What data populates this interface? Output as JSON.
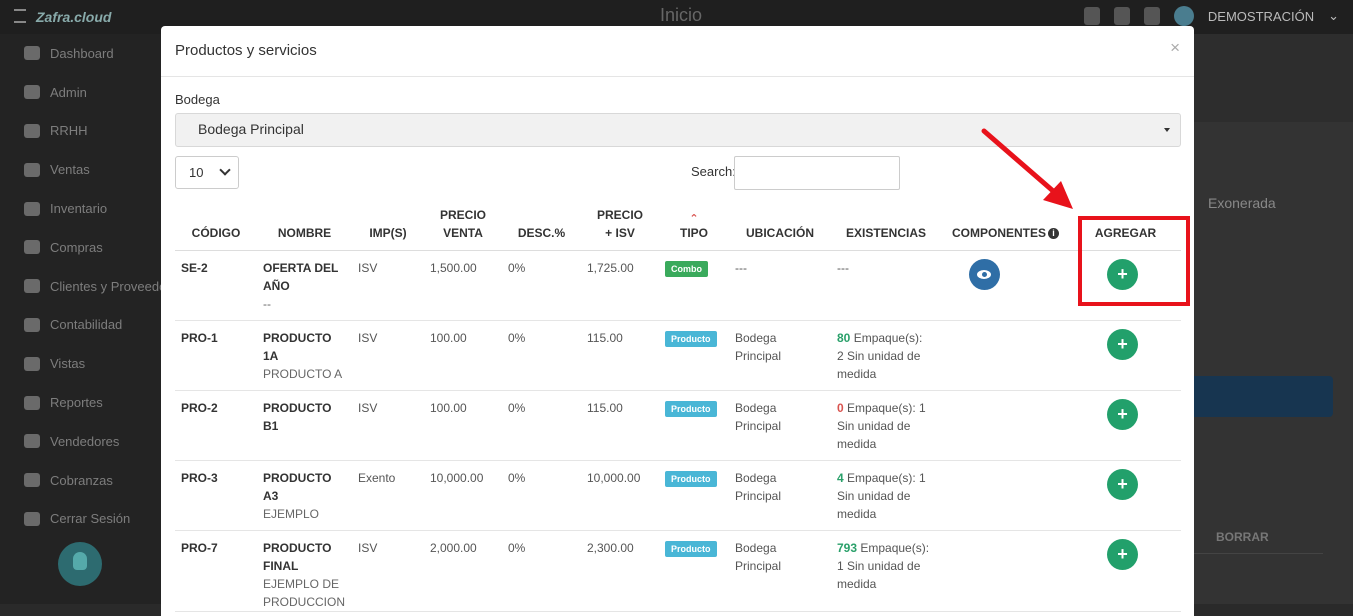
{
  "app": {
    "brand": "Zafra.cloud",
    "page_title": "Inicio",
    "user_label": "DEMOSTRACIÓN"
  },
  "sidebar": {
    "items": [
      {
        "label": "Dashboard"
      },
      {
        "label": "Admin"
      },
      {
        "label": "RRHH"
      },
      {
        "label": "Ventas"
      },
      {
        "label": "Inventario"
      },
      {
        "label": "Compras"
      },
      {
        "label": "Clientes y Proveedores"
      },
      {
        "label": "Contabilidad"
      },
      {
        "label": "Vistas"
      },
      {
        "label": "Reportes"
      },
      {
        "label": "Vendedores"
      },
      {
        "label": "Cobranzas"
      },
      {
        "label": "Cerrar Sesión"
      }
    ]
  },
  "background": {
    "exonerada": "Exonerada",
    "borrar": "BORRAR"
  },
  "modal": {
    "title": "Productos y servicios",
    "close": "×",
    "bodega_label": "Bodega",
    "bodega_value": "Bodega Principal",
    "page_length": "10",
    "search_label": "Search:",
    "search_value": ""
  },
  "table": {
    "headers": {
      "codigo": "CÓDIGO",
      "nombre": "NOMBRE",
      "imps": "IMP(S)",
      "precio_venta_1": "PRECIO",
      "precio_venta_2": "VENTA",
      "desc": "DESC.%",
      "precio_isv_1": "PRECIO",
      "precio_isv_2": "+ ISV",
      "tipo": "TIPO",
      "ubicacion": "UBICACIÓN",
      "existencias": "EXISTENCIAS",
      "componentes": "COMPONENTES",
      "agregar": "AGREGAR"
    },
    "rows": [
      {
        "code": "SE-2",
        "name_1": "OFERTA DEL",
        "name_2": "AÑO",
        "desc_text": "--",
        "imp": "ISV",
        "price": "1,500.00",
        "discount": "0%",
        "price_isv": "1,725.00",
        "type": "Combo",
        "location_1": "---",
        "location_2": "",
        "qty": "",
        "stock_text_1": "---",
        "stock_text_2": "",
        "stock_text_3": ""
      },
      {
        "code": "PRO-1",
        "name_1": "PRODUCTO",
        "name_2": "1A",
        "desc_text": "PRODUCTO A",
        "imp": "ISV",
        "price": "100.00",
        "discount": "0%",
        "price_isv": "115.00",
        "type": "Producto",
        "location_1": "Bodega",
        "location_2": "Principal",
        "qty": "80",
        "stock_text_1": " Empaque(s):",
        "stock_text_2": "2 Sin unidad de",
        "stock_text_3": "medida"
      },
      {
        "code": "PRO-2",
        "name_1": "PRODUCTO",
        "name_2": "B1",
        "desc_text": "",
        "imp": "ISV",
        "price": "100.00",
        "discount": "0%",
        "price_isv": "115.00",
        "type": "Producto",
        "location_1": "Bodega",
        "location_2": "Principal",
        "qty": "0",
        "stock_text_1": " Empaque(s): 1",
        "stock_text_2": "Sin unidad de",
        "stock_text_3": "medida"
      },
      {
        "code": "PRO-3",
        "name_1": "PRODUCTO",
        "name_2": "A3",
        "desc_text": "EJEMPLO",
        "imp": "Exento",
        "price": "10,000.00",
        "discount": "0%",
        "price_isv": "10,000.00",
        "type": "Producto",
        "location_1": "Bodega",
        "location_2": "Principal",
        "qty": "4",
        "stock_text_1": " Empaque(s): 1",
        "stock_text_2": "Sin unidad de",
        "stock_text_3": "medida"
      },
      {
        "code": "PRO-7",
        "name_1": "PRODUCTO",
        "name_2": "FINAL",
        "desc_text": "EJEMPLO DE PRODUCCION",
        "imp": "ISV",
        "price": "2,000.00",
        "discount": "0%",
        "price_isv": "2,300.00",
        "type": "Producto",
        "location_1": "Bodega",
        "location_2": "Principal",
        "qty": "793",
        "stock_text_1": " Empaque(s):",
        "stock_text_2": "1 Sin unidad de",
        "stock_text_3": "medida"
      }
    ],
    "add_symbol": "+"
  },
  "colors": {
    "accent_green": "#22a06b",
    "highlight_red": "#e8121b",
    "eye_blue": "#2f6ea6"
  }
}
